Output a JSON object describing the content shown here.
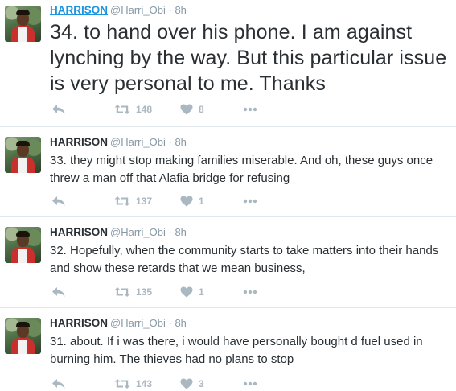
{
  "colors": {
    "link_blue": "#1b95e0",
    "text": "#292f33",
    "muted": "#8899a6",
    "action_gray": "#aab8c2",
    "divider": "#e1e8ed"
  },
  "tweets": [
    {
      "name": "HARRISON",
      "handle": "@Harri_Obi",
      "dot": "·",
      "time": "8h",
      "text": "34. to hand over his phone. I am against lynching by the way. But this particular issue is very personal to me. Thanks",
      "retweets": "148",
      "likes": "8",
      "icons": [
        "reply-icon",
        "retweet-icon",
        "heart-icon",
        "more-icon"
      ]
    },
    {
      "name": "HARRISON",
      "handle": "@Harri_Obi",
      "dot": "·",
      "time": "8h",
      "text": "33. they might stop making families miserable. And oh, these guys once threw a man off that Alafia bridge for refusing",
      "retweets": "137",
      "likes": "1",
      "icons": [
        "reply-icon",
        "retweet-icon",
        "heart-icon",
        "more-icon"
      ]
    },
    {
      "name": "HARRISON",
      "handle": "@Harri_Obi",
      "dot": "·",
      "time": "8h",
      "text": "32. Hopefully, when the community starts to take matters into their hands and show these retards that we mean business,",
      "retweets": "135",
      "likes": "1",
      "icons": [
        "reply-icon",
        "retweet-icon",
        "heart-icon",
        "more-icon"
      ]
    },
    {
      "name": "HARRISON",
      "handle": "@Harri_Obi",
      "dot": "·",
      "time": "8h",
      "text": "31. about. If i was there, i would have personally bought d fuel used in burning him. The thieves had no plans to stop",
      "retweets": "143",
      "likes": "3",
      "icons": [
        "reply-icon",
        "retweet-icon",
        "heart-icon",
        "more-icon"
      ]
    }
  ]
}
